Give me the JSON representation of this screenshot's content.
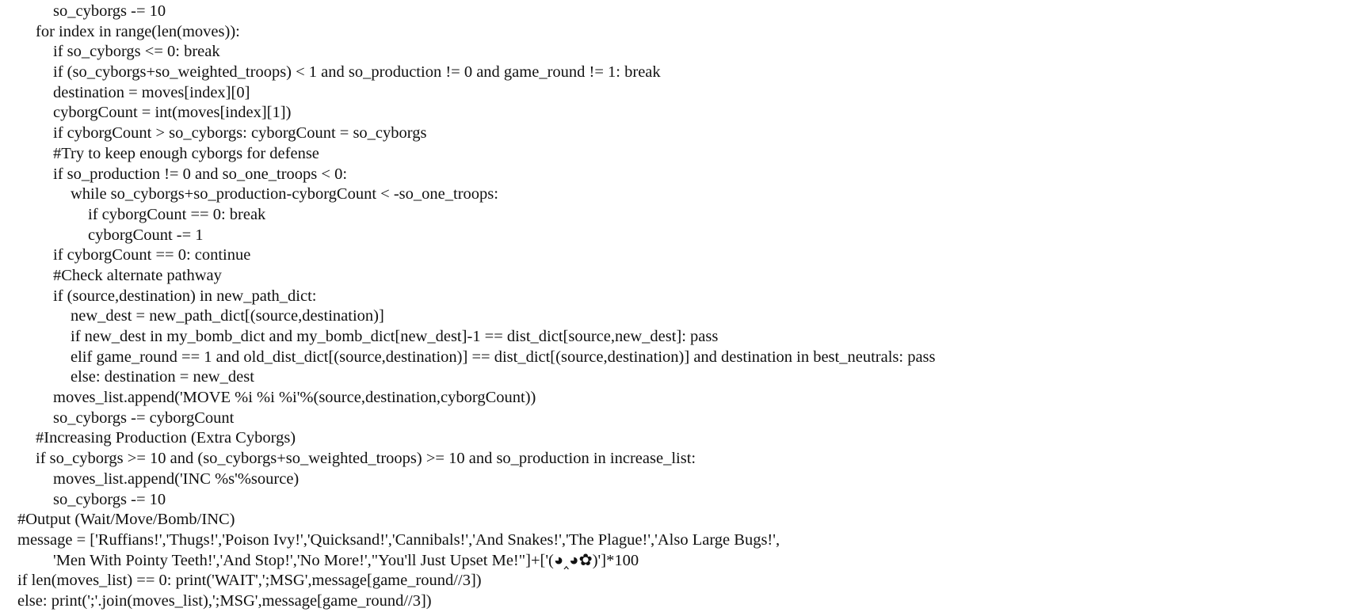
{
  "code": {
    "lines": [
      {
        "indent": 2,
        "text": "so_cyborgs -= 10"
      },
      {
        "indent": 1,
        "text": "for index in range(len(moves)):"
      },
      {
        "indent": 2,
        "text": "if so_cyborgs <= 0: break"
      },
      {
        "indent": 2,
        "text": "if (so_cyborgs+so_weighted_troops) < 1 and so_production != 0 and game_round != 1: break"
      },
      {
        "indent": 2,
        "text": "destination = moves[index][0]"
      },
      {
        "indent": 2,
        "text": "cyborgCount = int(moves[index][1])"
      },
      {
        "indent": 2,
        "text": "if cyborgCount > so_cyborgs: cyborgCount = so_cyborgs"
      },
      {
        "indent": 2,
        "text": "#Try to keep enough cyborgs for defense"
      },
      {
        "indent": 2,
        "text": "if so_production != 0 and so_one_troops < 0:"
      },
      {
        "indent": 3,
        "text": "while so_cyborgs+so_production-cyborgCount < -so_one_troops:"
      },
      {
        "indent": 4,
        "text": "if cyborgCount == 0: break"
      },
      {
        "indent": 4,
        "text": "cyborgCount -= 1"
      },
      {
        "indent": 2,
        "text": "if cyborgCount == 0: continue"
      },
      {
        "indent": 2,
        "text": "#Check alternate pathway"
      },
      {
        "indent": 2,
        "text": "if (source,destination) in new_path_dict:"
      },
      {
        "indent": 3,
        "text": "new_dest = new_path_dict[(source,destination)]"
      },
      {
        "indent": 3,
        "text": "if new_dest in my_bomb_dict and my_bomb_dict[new_dest]-1 == dist_dict[source,new_dest]: pass"
      },
      {
        "indent": 3,
        "text": "elif game_round == 1 and old_dist_dict[(source,destination)] == dist_dict[(source,destination)] and destination in best_neutrals: pass"
      },
      {
        "indent": 3,
        "text": "else: destination = new_dest"
      },
      {
        "indent": 2,
        "text": "moves_list.append('MOVE %i %i %i'%(source,destination,cyborgCount))"
      },
      {
        "indent": 2,
        "text": "so_cyborgs -= cyborgCount"
      },
      {
        "indent": 1,
        "text": "#Increasing Production (Extra Cyborgs)"
      },
      {
        "indent": 1,
        "text": "if so_cyborgs >= 10 and (so_cyborgs+so_weighted_troops) >= 10 and so_production in increase_list:"
      },
      {
        "indent": 2,
        "text": "moves_list.append('INC %s'%source)"
      },
      {
        "indent": 2,
        "text": "so_cyborgs -= 10"
      },
      {
        "indent": 0,
        "text": "#Output (Wait/Move/Bomb/INC)"
      },
      {
        "indent": 0,
        "text": "message = ['Ruffians!','Thugs!','Poison Ivy!','Quicksand!','Cannibals!','And Snakes!','The Plague!','Also Large Bugs!',"
      },
      {
        "indent": "cont",
        "text": "'Men With Pointy Teeth!','And Stop!','No More!',\"You'll Just Upset Me!\"]+['(◕‸◕✿)']*100"
      },
      {
        "indent": 0,
        "text": "if len(moves_list) == 0: print('WAIT',';MSG',message[game_round//3])"
      },
      {
        "indent": 0,
        "text": "else: print(';'.join(moves_list),';MSG',message[game_round//3])"
      }
    ]
  }
}
